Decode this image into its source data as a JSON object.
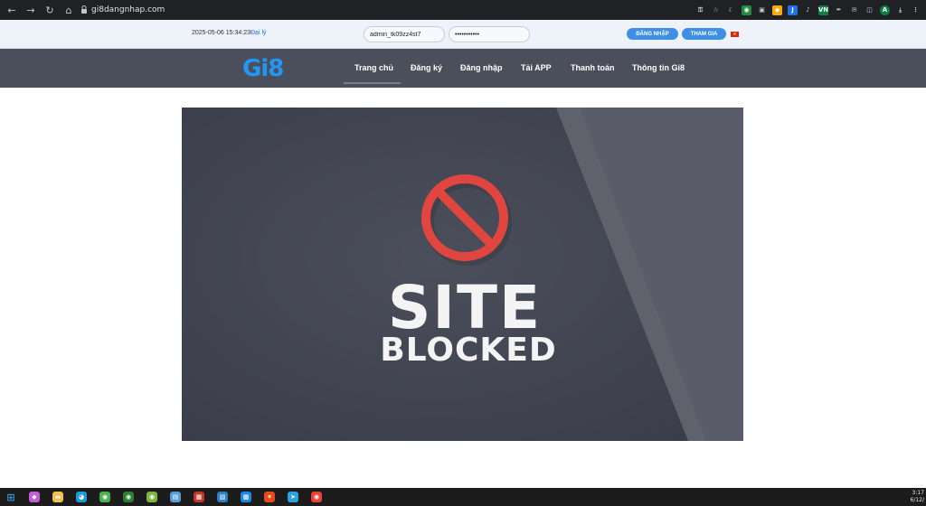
{
  "browser": {
    "url": "gi8dangnhap.com",
    "extensions": [
      {
        "name": "key-icon",
        "glyph": "⚿",
        "color": "#3c4043"
      },
      {
        "name": "star-icon",
        "glyph": "☆",
        "color": "#3c4043"
      },
      {
        "name": "moon-icon",
        "glyph": "☾",
        "color": "#3c4043"
      },
      {
        "name": "shield-extension-icon",
        "glyph": "◉",
        "color": "#1e8e3e"
      },
      {
        "name": "puzzle-extension-icon",
        "glyph": "▣",
        "color": "#5f6368"
      },
      {
        "name": "coupon-extension-icon",
        "glyph": "◆",
        "color": "#f9ab00"
      },
      {
        "name": "j-extension-icon",
        "glyph": "J",
        "color": "#1a73e8"
      },
      {
        "name": "mic-icon",
        "glyph": "♪",
        "color": "#3c4043"
      },
      {
        "name": "vn-extension-icon",
        "glyph": "VN",
        "color": "#0b8043"
      },
      {
        "name": "pen-extension-icon",
        "glyph": "✒",
        "color": "#3c4043"
      },
      {
        "name": "chat-extension-icon",
        "glyph": "✉",
        "color": "#3c4043"
      },
      {
        "name": "sidebar-icon",
        "glyph": "◫",
        "color": "#3c4043"
      },
      {
        "name": "profile-avatar-icon",
        "glyph": "A",
        "color": "#0b8043"
      },
      {
        "name": "download-icon",
        "glyph": "⤓",
        "color": "#3c4043"
      },
      {
        "name": "menu-icon",
        "glyph": "⋮",
        "color": "#3c4043"
      }
    ]
  },
  "top_strip": {
    "datetime": "2025-05-06 15:34:23",
    "agent_link": "Đại lý",
    "username_value": "admin_tk09zz4st7",
    "password_value": "•••••••••••",
    "login_button": "ĐĂNG NHẬP",
    "join_button": "THAM GIA"
  },
  "main_nav": {
    "logo": "Gi8",
    "items": [
      "Trang chủ",
      "Đăng ký",
      "Đăng nhập",
      "Tải APP",
      "Thanh toán",
      "Thông tin Gi8"
    ],
    "active_index": 0
  },
  "content": {
    "blocked_line1": "SITE",
    "blocked_line2": "BLOCKED"
  },
  "taskbar": {
    "apps": [
      {
        "name": "windows-start-icon",
        "glyph": "⊞",
        "color": "#3a96dd"
      },
      {
        "name": "copilot-icon",
        "glyph": "◆",
        "color": "#c35cd8"
      },
      {
        "name": "file-explorer-icon",
        "glyph": "▬",
        "color": "#f2c14b"
      },
      {
        "name": "edge-icon",
        "glyph": "◕",
        "color": "#1d9bd7"
      },
      {
        "name": "chrome-green-icon",
        "glyph": "◉",
        "color": "#4caf50"
      },
      {
        "name": "chrome-active-icon",
        "glyph": "◉",
        "color": "#2e7d32"
      },
      {
        "name": "chrome-canary-icon",
        "glyph": "◉",
        "color": "#7cb342"
      },
      {
        "name": "notepad-icon",
        "glyph": "▤",
        "color": "#5b9bd5"
      },
      {
        "name": "photo-app-icon",
        "glyph": "▦",
        "color": "#c0392b"
      },
      {
        "name": "paint-app-icon",
        "glyph": "▧",
        "color": "#2f7ec1"
      },
      {
        "name": "screenshot-app-icon",
        "glyph": "▩",
        "color": "#1e88e5"
      },
      {
        "name": "color-app-icon",
        "glyph": "✶",
        "color": "#e64a19"
      },
      {
        "name": "telegram-icon",
        "glyph": "➤",
        "color": "#2aa3e0"
      },
      {
        "name": "chrome-icon",
        "glyph": "◉",
        "color": "#ea4335"
      }
    ],
    "clock_time": "3:17",
    "clock_date": "6/12/"
  }
}
